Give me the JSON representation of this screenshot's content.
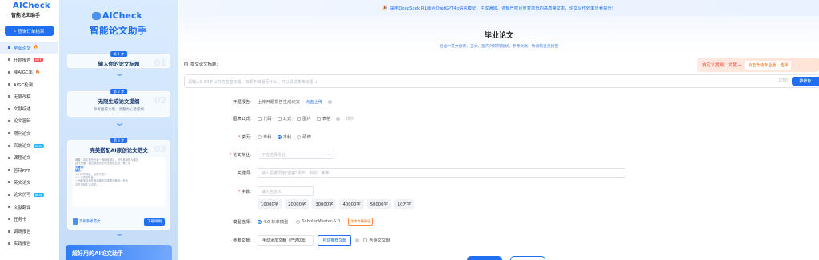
{
  "sidebar": {
    "logo_title": "AICheck",
    "logo_sub": "智能论文助手",
    "query_button": "查询订单结果",
    "items": [
      {
        "label": "毕业论文",
        "icon": "book-icon",
        "badge": "🔥",
        "badge_type": "fire",
        "active": true
      },
      {
        "label": "开题报告",
        "icon": "report-icon",
        "badge": "HOT",
        "badge_type": "hot"
      },
      {
        "label": "降AIGC率",
        "icon": "shield-icon",
        "badge": "🔥",
        "badge_type": "fire"
      },
      {
        "label": "AIGC检测",
        "icon": "scan-icon"
      },
      {
        "label": "无限改稿",
        "icon": "edit-icon"
      },
      {
        "label": "文献综述",
        "icon": "document-icon"
      },
      {
        "label": "论文答辩",
        "icon": "chat-icon"
      },
      {
        "label": "期刊论文",
        "icon": "journal-icon"
      },
      {
        "label": "高端论文",
        "icon": "star-icon",
        "badge": "NEW",
        "badge_type": "new"
      },
      {
        "label": "课程论文",
        "icon": "course-icon"
      },
      {
        "label": "答辩PPT",
        "icon": "ppt-icon"
      },
      {
        "label": "英文论文",
        "icon": "globe-icon"
      },
      {
        "label": "论文仿写",
        "icon": "copy-icon",
        "badge": "NEW",
        "badge_type": "new"
      },
      {
        "label": "文献翻译",
        "icon": "translate-icon"
      },
      {
        "label": "任务书",
        "icon": "task-icon"
      },
      {
        "label": "调研报告",
        "icon": "survey-icon"
      },
      {
        "label": "实践报告",
        "icon": "practice-icon"
      }
    ]
  },
  "promo": {
    "brand": "AICheck",
    "title": "智能论文助手",
    "steps": [
      {
        "tag": "第 1 步",
        "title": "输入你的论文标题",
        "num": "01"
      },
      {
        "tag": "第 2 步",
        "title": "无限生成论文提纲",
        "desc": "参考推荐大纲，调整为心意提纲",
        "num": "02"
      },
      {
        "tag": "第 3 步",
        "title": "完美搭配AI原创论文范文",
        "num": "03"
      }
    ],
    "preview_lines": [
      "摘要：本文首先分析一间网络现状，研究其管理与维护",
      "运行策略，通过数据对比得出改进意见，第三章",
      "关键词：",
      "绪论：",
      "1.1 研究背景、目的与意义",
      "1.1.1 研究背景",
      "一间教室当前在各领域中的重要问题和一系列",
      "并在日常生活中的..."
    ],
    "file_chip": "实例参考范文",
    "download_btn": "下载样例",
    "footer": "超好用的AI论文助手"
  },
  "main": {
    "top_banner": "采用DeepSeek R1融合ChatGPT4o语言模型，生成通顺、逻辑严密且重复率低的高质量文本，论文写作效率显著提升！",
    "title": "毕业论文",
    "subtitle": "包含中英文摘要、正文、国内外研究现状、参考文献、致谢和查重报告",
    "topic_label": "提交论文标题:",
    "topic_placeholder": "请输入5-50字以内的完整标题，如果不知道写什么，可以试试推荐标题 ↓",
    "topic_count": "0/50",
    "recommend_btn": "推荐标",
    "promo_red": "自定义提纲、文献 →",
    "promo_upgrade": "点击升级专业版，选择"
  },
  "form": {
    "proposal": {
      "label": "开题报告:",
      "text": "上传开题报告生成论文",
      "link": "点击上传"
    },
    "charts": {
      "label": "图表公式:",
      "options": [
        "代码",
        "公式",
        "图片",
        "表格"
      ],
      "sample": "样例"
    },
    "degree": {
      "label": "学历:",
      "options": [
        "专科",
        "本科",
        "硕博"
      ],
      "selected": "本科"
    },
    "major": {
      "label": "论文专业:",
      "placeholder": "下拉选择专业"
    },
    "keywords": {
      "label": "关键词:",
      "placeholder": "输入关键词用\"空格\"隔开，例如：某某..."
    },
    "wordcount": {
      "label": "字数:",
      "placeholder": "输入自定义",
      "chips": [
        "10000字",
        "20000字",
        "30000字",
        "40000字",
        "50000字",
        "10万字"
      ]
    },
    "model": {
      "label": "模型选择:",
      "options": [
        "4.0 标准模型",
        "ScholarMaster-5.0"
      ],
      "selected": "4.0 标准模型",
      "tag": "学术专精更强"
    },
    "refs": {
      "label": "参考文献:",
      "manual_btn": "手动添加文献（已选0篇）",
      "auto_btn": "自动推荐文献",
      "english": "含英文文献"
    }
  },
  "colors": {
    "accent": "#1f6ff0",
    "hot": "#ff4d4f",
    "new": "#2db7f5",
    "orange": "#ff6a00"
  }
}
